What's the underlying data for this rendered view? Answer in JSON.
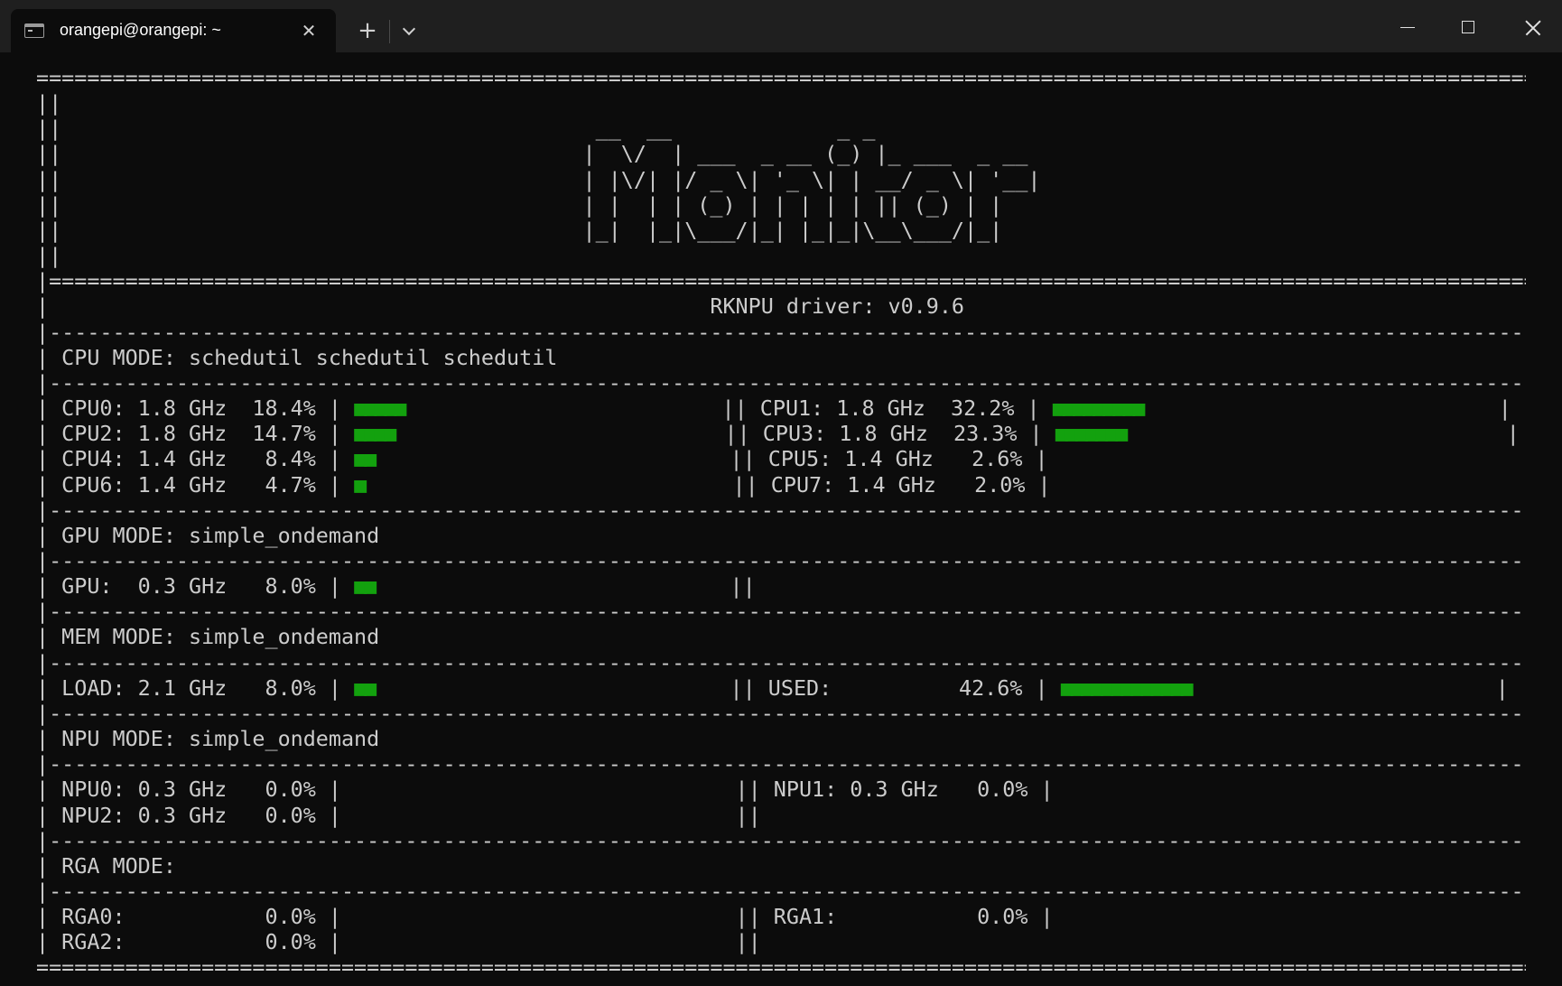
{
  "window": {
    "tab_title": "orangepi@orangepi: ~",
    "tab_close_glyph": "✕",
    "new_tab_glyph": "+"
  },
  "terminal": {
    "lines": [
      "=============================================================================================================================",
      "||                                                                                                                         ||",
      "||                                          __  __             _ _                                                          ||",
      "||                                         |  \\/  | ___  _ __ (_) |_ ___  _ __                                             ||",
      "||                                         | |\\/| |/ _ \\| '_ \\| | __/ _ \\| '__|                                            ||",
      "||                                         | |  | | (_) | | | | | || (_) | |                                               ||",
      "||                                         |_|  |_|\\___/|_| |_|_|\\__\\___/|_|                                               ||",
      "||                                                                                                                         ||",
      "|===========================================================================================================================|",
      "|                                                    RKNPU driver: v0.9.6                                                   |",
      "|---------------------------------------------------------------------------------------------------------------------------|",
      "| CPU MODE: schedutil schedutil schedutil                                                                                   |",
      "|---------------------------------------------------------------------------------------------------------------------------|",
      "| CPU0: 1.8 GHz  18.4% | ■■■■■                         || CPU1: 1.8 GHz  32.2% | ■■■■■■■■■                            |",
      "| CPU2: 1.8 GHz  14.7% | ■■■■                          || CPU3: 1.8 GHz  23.3% | ■■■■■■■                              |",
      "| CPU4: 1.4 GHz   8.4% | ■■                            || CPU5: 1.4 GHz   2.6% |                                      |",
      "| CPU6: 1.4 GHz   4.7% | ■                             || CPU7: 1.4 GHz   2.0% |                                      |",
      "|---------------------------------------------------------------------------------------------------------------------------|",
      "| GPU MODE: simple_ondemand                                                                                                 |",
      "|---------------------------------------------------------------------------------------------------------------------------|",
      "| GPU:  0.3 GHz   8.0% | ■■                            ||                                                                  |",
      "|---------------------------------------------------------------------------------------------------------------------------|",
      "| MEM MODE: simple_ondemand                                                                                                 |",
      "|---------------------------------------------------------------------------------------------------------------------------|",
      "| LOAD: 2.1 GHz   8.0% | ■■                            || USED:          42.6% | ■■■■■■■■■■■■■                        |",
      "|---------------------------------------------------------------------------------------------------------------------------|",
      "| NPU MODE: simple_ondemand                                                                                                 |",
      "|---------------------------------------------------------------------------------------------------------------------------|",
      "| NPU0: 0.3 GHz   0.0% |                               || NPU1: 0.3 GHz   0.0% |                                      |",
      "| NPU2: 0.3 GHz   0.0% |                               ||                                                                  |",
      "|---------------------------------------------------------------------------------------------------------------------------|",
      "| RGA MODE:                                                                                                                 |",
      "|---------------------------------------------------------------------------------------------------------------------------|",
      "| RGA0:           0.0% |                               || RGA1:           0.0% |                                      |",
      "| RGA2:           0.0% |                               ||                                                                  |",
      "============================================================================================================================="
    ],
    "colors": {
      "background": "#0c0c0c",
      "text": "#cccccc",
      "bar": "#13a10e"
    }
  }
}
